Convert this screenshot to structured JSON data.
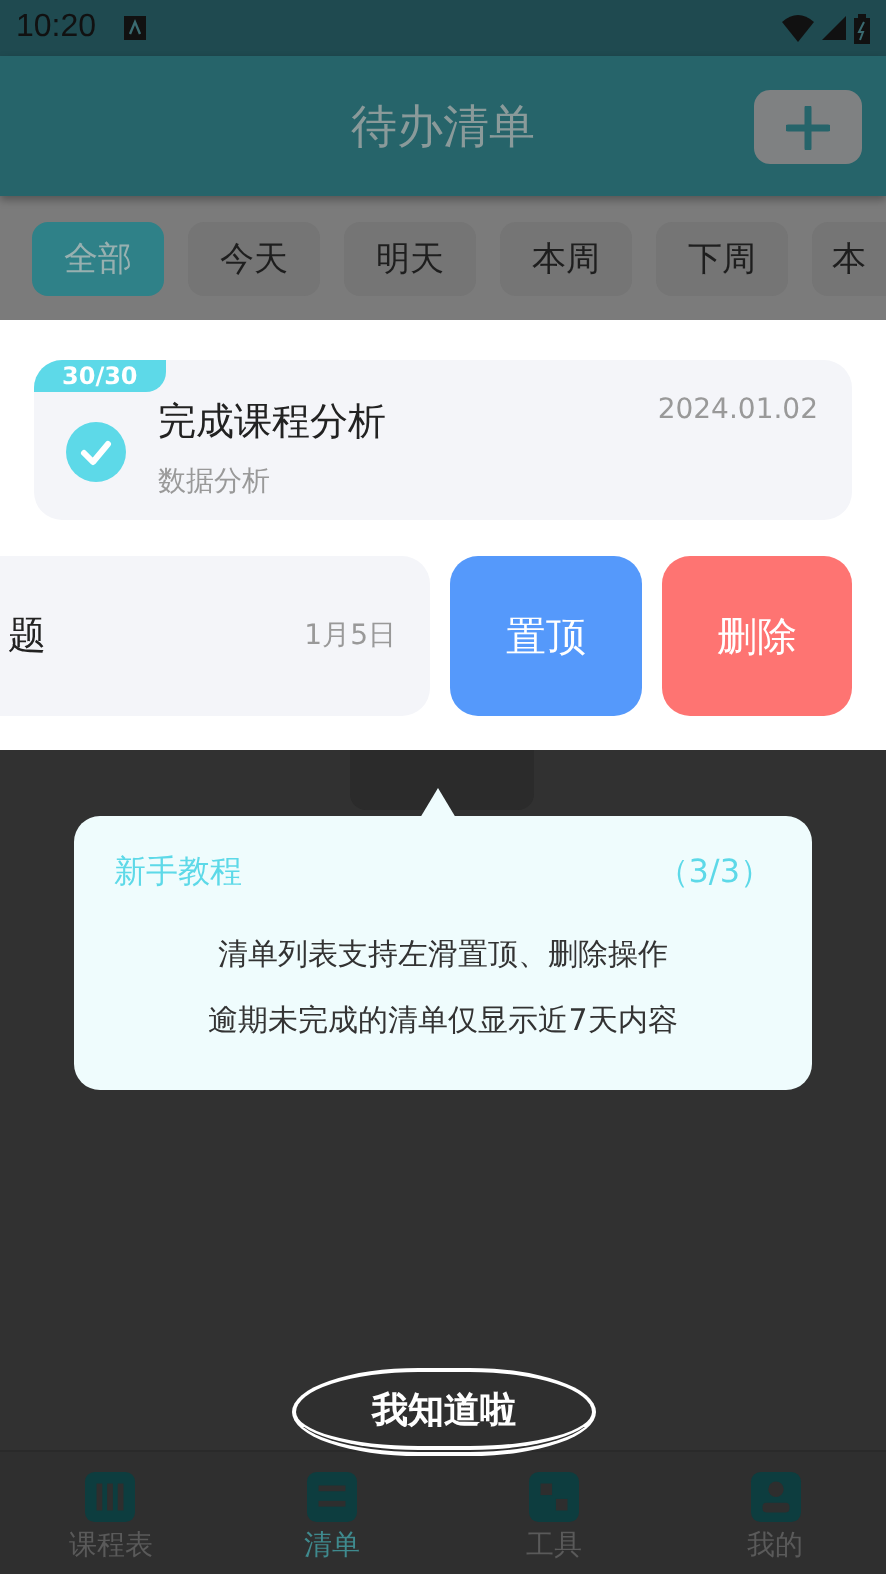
{
  "status_bar": {
    "time": "10:20"
  },
  "header": {
    "title": "待办清单"
  },
  "filters": [
    {
      "label": "全部",
      "selected": true
    },
    {
      "label": "今天",
      "selected": false
    },
    {
      "label": "明天",
      "selected": false
    },
    {
      "label": "本周",
      "selected": false
    },
    {
      "label": "下周",
      "selected": false
    },
    {
      "label": "本",
      "selected": false
    }
  ],
  "todos": [
    {
      "badge": "30/30",
      "title": "完成课程分析",
      "subtitle": "数据分析",
      "date": "2024.01.02",
      "checked": true,
      "swiped": false
    },
    {
      "title": "题",
      "date": "1月5日",
      "swiped": true,
      "actions": [
        {
          "kind": "pin",
          "label": "置顶"
        },
        {
          "kind": "delete",
          "label": "删除"
        }
      ]
    }
  ],
  "tutorial": {
    "title": "新手教程",
    "step": "（3/3）",
    "lines": [
      "清单列表支持左滑置顶、删除操作",
      "逾期未完成的清单仅显示近7天内容"
    ]
  },
  "dismiss_button": "我知道啦",
  "tabs": [
    {
      "label": "课程表",
      "kind": "schedule",
      "selected": false
    },
    {
      "label": "清单",
      "kind": "list",
      "selected": true
    },
    {
      "label": "工具",
      "kind": "tools",
      "selected": false
    },
    {
      "label": "我的",
      "kind": "profile",
      "selected": false
    }
  ]
}
